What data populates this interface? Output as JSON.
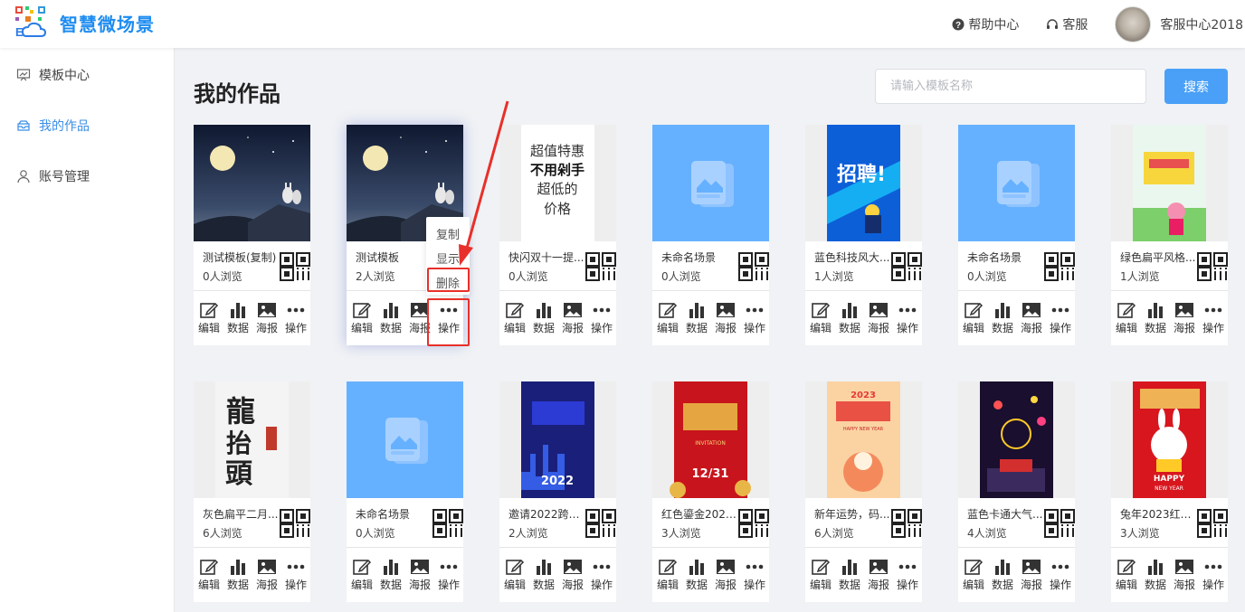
{
  "header": {
    "brand": "智慧微场景",
    "help": "帮助中心",
    "service": "客服",
    "user": "客服中心2018"
  },
  "sidebar": {
    "items": [
      {
        "label": "模板中心",
        "icon": "template-icon"
      },
      {
        "label": "我的作品",
        "icon": "works-icon",
        "active": true
      },
      {
        "label": "账号管理",
        "icon": "user-icon"
      }
    ]
  },
  "main": {
    "title": "我的作品",
    "search_placeholder": "请输入模板名称",
    "search_button": "搜索"
  },
  "actions": {
    "edit": "编辑",
    "data": "数据",
    "poster": "海报",
    "more": "操作"
  },
  "popup_menu": [
    "复制",
    "显示",
    "删除"
  ],
  "cards": [
    {
      "name": "测试模板(复制)",
      "views": "0人浏览",
      "thumb": "moon-night"
    },
    {
      "name": "测试模板",
      "views": "2人浏览",
      "thumb": "moon-night"
    },
    {
      "name": "快闪双十一提...",
      "views": "0人浏览",
      "thumb": "text-poster",
      "poster_text": [
        "超值特惠",
        "不用剁手",
        "超低的",
        "价格"
      ]
    },
    {
      "name": "未命名场景",
      "views": "0人浏览",
      "thumb": "blank"
    },
    {
      "name": "蓝色科技风大...",
      "views": "1人浏览",
      "thumb": "recruit-blue",
      "poster_text": [
        "招聘!"
      ]
    },
    {
      "name": "未命名场景",
      "views": "0人浏览",
      "thumb": "blank"
    },
    {
      "name": "绿色扁平风格...",
      "views": "1人浏览",
      "thumb": "green-flat"
    },
    {
      "name": "灰色扁平二月...",
      "views": "6人浏览",
      "thumb": "calligraphy",
      "poster_text": [
        "龍",
        "抬",
        "頭"
      ]
    },
    {
      "name": "未命名场景",
      "views": "0人浏览",
      "thumb": "blank"
    },
    {
      "name": "邀请2022跨年...",
      "views": "2人浏览",
      "thumb": "invite-2022",
      "poster_text": [
        "2022"
      ]
    },
    {
      "name": "红色鎏金2023...",
      "views": "3人浏览",
      "thumb": "red-gold",
      "poster_text": [
        "12/31",
        "INVITATION"
      ]
    },
    {
      "name": "新年运势，码...",
      "views": "6人浏览",
      "thumb": "new-year-fortune",
      "poster_text": [
        "2023",
        "HAPPY NEW YEAR"
      ]
    },
    {
      "name": "蓝色卡通大气...",
      "views": "4人浏览",
      "thumb": "dark-cartoon"
    },
    {
      "name": "兔年2023红色...",
      "views": "3人浏览",
      "thumb": "rabbit-red",
      "poster_text": [
        "HAPPY",
        "NEW YEAR"
      ]
    }
  ]
}
